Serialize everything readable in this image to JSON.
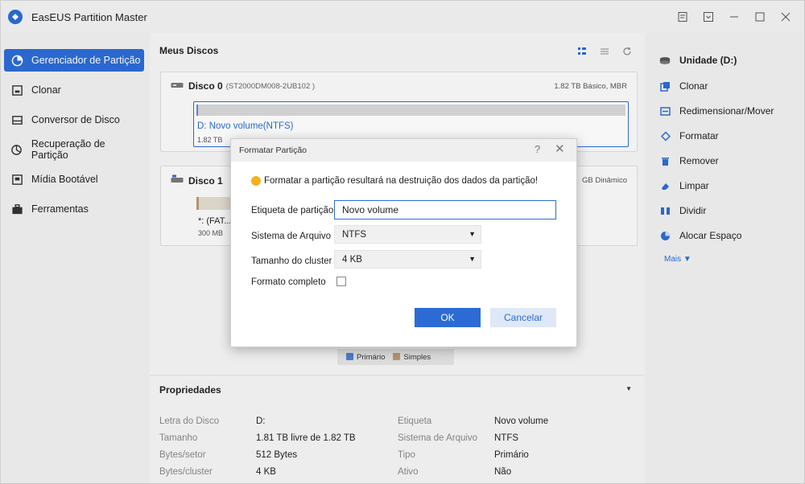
{
  "app": {
    "title": "EasEUS Partition Master"
  },
  "sidebar": {
    "items": [
      {
        "label": "Gerenciador de Partição",
        "icon": "partition-manager-icon",
        "active": true
      },
      {
        "label": "Clonar",
        "icon": "clone-icon"
      },
      {
        "label": "Conversor de Disco",
        "icon": "disk-converter-icon"
      },
      {
        "label": "Recuperação de Partição",
        "icon": "partition-recovery-icon"
      },
      {
        "label": "Mídia Bootável",
        "icon": "bootable-media-icon"
      },
      {
        "label": "Ferramentas",
        "icon": "toolbox-icon"
      }
    ]
  },
  "main": {
    "title": "Meus Discos",
    "disks": [
      {
        "name": "Disco 0",
        "model": "(ST2000DM008-2UB102 )",
        "info": "1.82 TB Básico, MBR",
        "partition": {
          "label": "D: Novo volume(NTFS)",
          "size": "1.82 TB",
          "used_fraction": 0.003
        }
      },
      {
        "name": "Disco 1",
        "model": "(...)",
        "info": "GB Dinâmico",
        "partition": {
          "label": "*: (FAT...",
          "size": "300 MB"
        }
      }
    ],
    "legend": [
      {
        "label": "Primário",
        "color": "#4e7fd6"
      },
      {
        "label": "Simples",
        "color": "#b89b72"
      }
    ]
  },
  "properties": {
    "title": "Propriedades",
    "left": [
      {
        "k": "Letra do Disco",
        "v": "D:"
      },
      {
        "k": "Tamanho",
        "v": "1.81 TB livre de 1.82 TB"
      },
      {
        "k": "Bytes/setor",
        "v": "512 Bytes"
      },
      {
        "k": "Bytes/cluster",
        "v": "4 KB"
      }
    ],
    "right": [
      {
        "k": "Etiqueta",
        "v": "Novo volume"
      },
      {
        "k": "Sistema de Arquivo",
        "v": "NTFS"
      },
      {
        "k": "Tipo",
        "v": "Primário"
      },
      {
        "k": "Ativo",
        "v": "Não"
      }
    ]
  },
  "right_panel": {
    "header": "Unidade (D:)",
    "actions": [
      {
        "label": "Clonar",
        "icon": "clone-icon"
      },
      {
        "label": "Redimensionar/Mover",
        "icon": "resize-move-icon"
      },
      {
        "label": "Formatar",
        "icon": "format-icon"
      },
      {
        "label": "Remover",
        "icon": "trash-icon"
      },
      {
        "label": "Limpar",
        "icon": "eraser-icon"
      },
      {
        "label": "Dividir",
        "icon": "split-icon"
      },
      {
        "label": "Alocar Espaço",
        "icon": "allocate-space-icon"
      }
    ],
    "more": "Mais ▼"
  },
  "dialog": {
    "title": "Formatar Partição",
    "warning": "Formatar a partição resultará na destruição dos dados da partição!",
    "label_field": {
      "label": "Etiqueta de partição",
      "value": "Novo volume"
    },
    "filesystem": {
      "label": "Sistema de Arquivo",
      "value": "NTFS"
    },
    "cluster": {
      "label": "Tamanho do cluster",
      "value": "4 KB"
    },
    "full_format": {
      "label": "Formato completo",
      "checked": false
    },
    "ok": "OK",
    "cancel": "Cancelar"
  },
  "colors": {
    "accent": "#2c6bd6",
    "warning": "#f3b21b"
  }
}
